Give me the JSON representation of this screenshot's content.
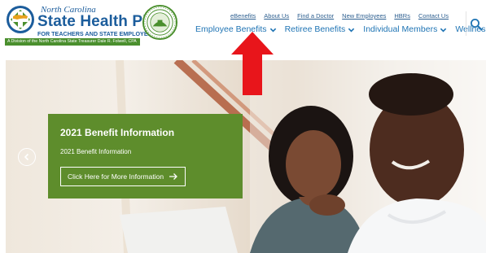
{
  "logo": {
    "state_line": "North Carolina",
    "title": "State Health Plan",
    "subtitle": "FOR TEACHERS AND STATE EMPLOYEES",
    "division": "A Division of the North Carolina State Treasurer Dale R. Folwell, CPA"
  },
  "utility_nav": [
    "eBenefits",
    "About Us",
    "Find a Doctor",
    "New Employees",
    "HBRs",
    "Contact Us"
  ],
  "main_nav": [
    "Employee Benefits",
    "Retiree Benefits",
    "Individual Members",
    "Wellness"
  ],
  "icons": {
    "search": "search-icon",
    "chevron": "chevron-down-icon",
    "prev": "chevron-left-icon",
    "arrow_right": "arrow-right-icon"
  },
  "hero": {
    "title": "2021 Benefit Information",
    "subtitle": "2021 Benefit Information",
    "cta": "Click Here for More Information"
  },
  "colors": {
    "brand_blue": "#1c5d9c",
    "nav_blue": "#1f74b4",
    "promo_green": "#5e8d2c",
    "annotation_red": "#e8151b"
  }
}
